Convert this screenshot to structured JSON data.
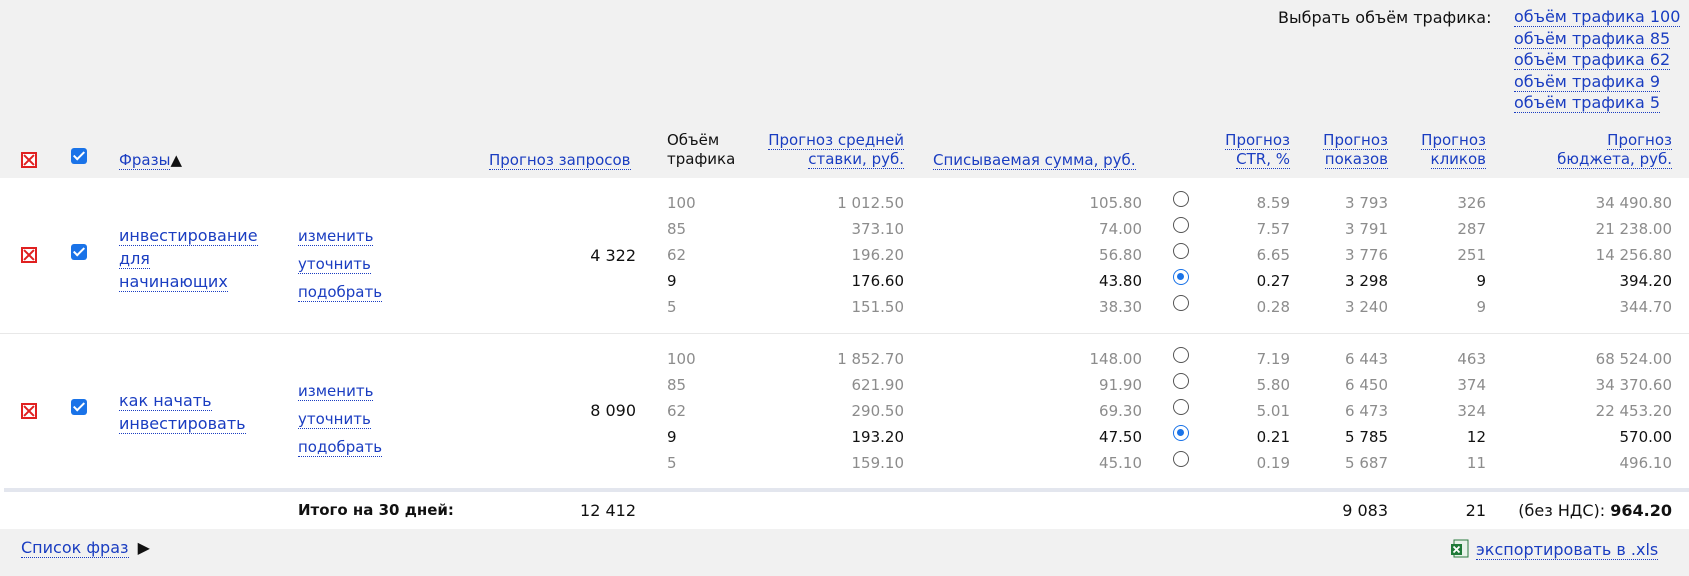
{
  "traffic": {
    "label": "Выбрать объём трафика:",
    "options": [
      "объём трафика 100",
      "объём трафика 85",
      "объём трафика 62",
      "объём трафика 9",
      "объём трафика 5"
    ]
  },
  "header": {
    "phrases": "Фразы",
    "sort_arrow": "▲",
    "forecast_requests": "Прогноз запросов",
    "traffic_volume_1": "Объём",
    "traffic_volume_2": "трафика",
    "avg_bid_1": "Прогноз средней",
    "avg_bid_2": "ставки, руб.",
    "charge": "Списываемая сумма, руб.",
    "ctr_1": "Прогноз",
    "ctr_2": "CTR, %",
    "shows_1": "Прогноз",
    "shows_2": "показов",
    "clicks_1": "Прогноз",
    "clicks_2": "кликов",
    "budget_1": "Прогноз",
    "budget_2": "бюджета, руб."
  },
  "actions": {
    "change": "изменить",
    "refine": "уточнить",
    "pick": "подобрать"
  },
  "groups": [
    {
      "phrase_lines": [
        "инвестирование",
        "для",
        "начинающих"
      ],
      "requests": "4 322",
      "rows": [
        {
          "vol": "100",
          "bid": "1 012.50",
          "charge": "105.80",
          "ctr": "8.59",
          "shows": "3 793",
          "clicks": "326",
          "budget": "34 490.80",
          "selected": false
        },
        {
          "vol": "85",
          "bid": "373.10",
          "charge": "74.00",
          "ctr": "7.57",
          "shows": "3 791",
          "clicks": "287",
          "budget": "21 238.00",
          "selected": false
        },
        {
          "vol": "62",
          "bid": "196.20",
          "charge": "56.80",
          "ctr": "6.65",
          "shows": "3 776",
          "clicks": "251",
          "budget": "14 256.80",
          "selected": false
        },
        {
          "vol": "9",
          "bid": "176.60",
          "charge": "43.80",
          "ctr": "0.27",
          "shows": "3 298",
          "clicks": "9",
          "budget": "394.20",
          "selected": true
        },
        {
          "vol": "5",
          "bid": "151.50",
          "charge": "38.30",
          "ctr": "0.28",
          "shows": "3 240",
          "clicks": "9",
          "budget": "344.70",
          "selected": false
        }
      ]
    },
    {
      "phrase_lines": [
        "как начать",
        "инвестировать"
      ],
      "requests": "8 090",
      "rows": [
        {
          "vol": "100",
          "bid": "1 852.70",
          "charge": "148.00",
          "ctr": "7.19",
          "shows": "6 443",
          "clicks": "463",
          "budget": "68 524.00",
          "selected": false
        },
        {
          "vol": "85",
          "bid": "621.90",
          "charge": "91.90",
          "ctr": "5.80",
          "shows": "6 450",
          "clicks": "374",
          "budget": "34 370.60",
          "selected": false
        },
        {
          "vol": "62",
          "bid": "290.50",
          "charge": "69.30",
          "ctr": "5.01",
          "shows": "6 473",
          "clicks": "324",
          "budget": "22 453.20",
          "selected": false
        },
        {
          "vol": "9",
          "bid": "193.20",
          "charge": "47.50",
          "ctr": "0.21",
          "shows": "5 785",
          "clicks": "12",
          "budget": "570.00",
          "selected": true
        },
        {
          "vol": "5",
          "bid": "159.10",
          "charge": "45.10",
          "ctr": "0.19",
          "shows": "5 687",
          "clicks": "11",
          "budget": "496.10",
          "selected": false
        }
      ]
    }
  ],
  "totals": {
    "label": "Итого на 30 дней:",
    "requests": "12 412",
    "shows": "9 083",
    "clicks": "21",
    "vat_label": "(без НДС):",
    "budget": "964.20"
  },
  "footer": {
    "phrase_list": "Список фраз",
    "phrase_list_arrow": "▶",
    "export": "экспортировать в .xls"
  },
  "colors": {
    "link": "#1a3dc1",
    "accent": "#1a73e8",
    "delete": "#e02020",
    "muted": "#8c8c8c"
  }
}
